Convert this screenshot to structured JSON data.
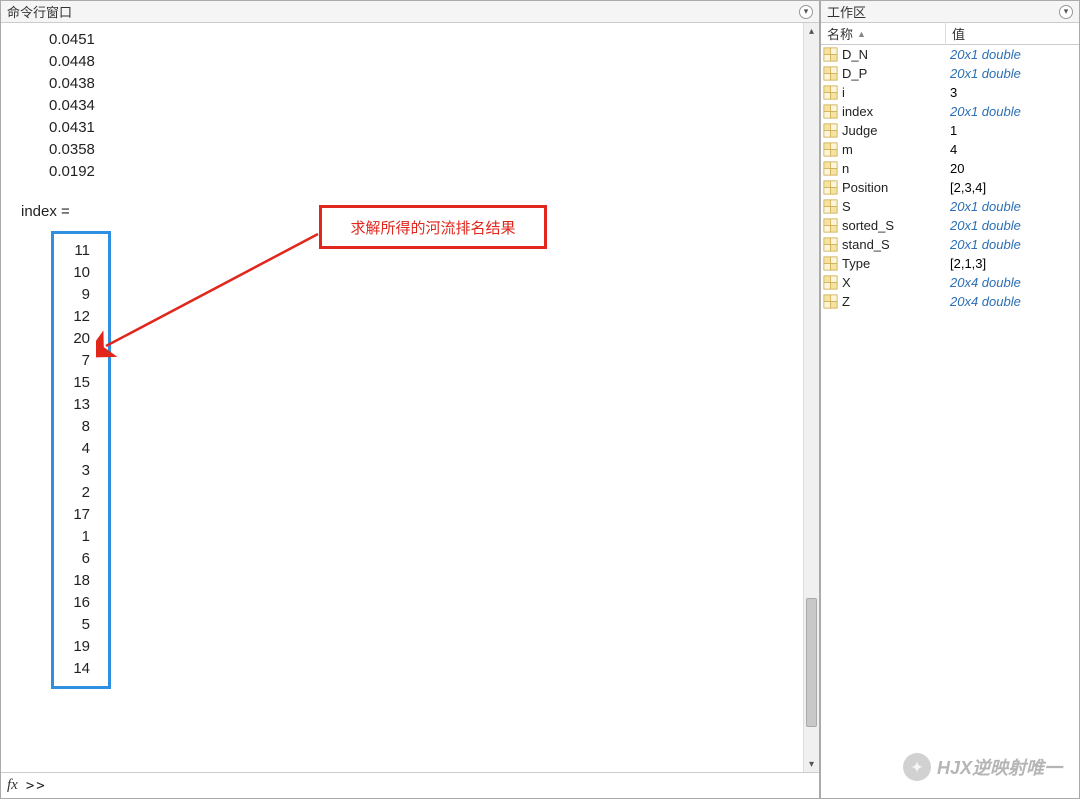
{
  "cmd": {
    "title": "命令行窗口",
    "pre_values": [
      "0.0451",
      "0.0448",
      "0.0438",
      "0.0434",
      "0.0431",
      "0.0358",
      "0.0192"
    ],
    "var_label": "index =",
    "index_values": [
      11,
      10,
      9,
      12,
      20,
      7,
      15,
      13,
      8,
      4,
      3,
      2,
      17,
      1,
      6,
      18,
      16,
      5,
      19,
      14
    ],
    "fx": "fx",
    "prompt": ">>"
  },
  "annotation": {
    "text": "求解所得的河流排名结果"
  },
  "workspace": {
    "title": "工作区",
    "columns": {
      "name": "名称",
      "value": "值"
    },
    "rows": [
      {
        "name": "D_N",
        "value": "20x1 double",
        "italic": true
      },
      {
        "name": "D_P",
        "value": "20x1 double",
        "italic": true
      },
      {
        "name": "i",
        "value": "3",
        "italic": false
      },
      {
        "name": "index",
        "value": "20x1 double",
        "italic": true
      },
      {
        "name": "Judge",
        "value": "1",
        "italic": false
      },
      {
        "name": "m",
        "value": "4",
        "italic": false
      },
      {
        "name": "n",
        "value": "20",
        "italic": false
      },
      {
        "name": "Position",
        "value": "[2,3,4]",
        "italic": false
      },
      {
        "name": "S",
        "value": "20x1 double",
        "italic": true
      },
      {
        "name": "sorted_S",
        "value": "20x1 double",
        "italic": true
      },
      {
        "name": "stand_S",
        "value": "20x1 double",
        "italic": true
      },
      {
        "name": "Type",
        "value": "[2,1,3]",
        "italic": false
      },
      {
        "name": "X",
        "value": "20x4 double",
        "italic": true
      },
      {
        "name": "Z",
        "value": "20x4 double",
        "italic": true
      }
    ]
  },
  "watermark": {
    "text": "HJX逆映射唯一"
  }
}
